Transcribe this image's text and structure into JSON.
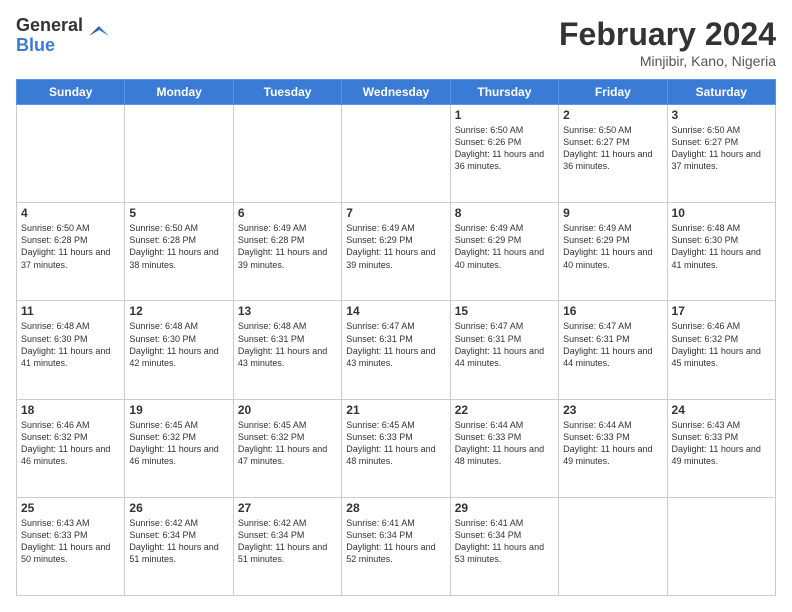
{
  "logo": {
    "general": "General",
    "blue": "Blue"
  },
  "header": {
    "month": "February 2024",
    "location": "Minjibir, Kano, Nigeria"
  },
  "days_of_week": [
    "Sunday",
    "Monday",
    "Tuesday",
    "Wednesday",
    "Thursday",
    "Friday",
    "Saturday"
  ],
  "weeks": [
    [
      {
        "day": "",
        "info": ""
      },
      {
        "day": "",
        "info": ""
      },
      {
        "day": "",
        "info": ""
      },
      {
        "day": "",
        "info": ""
      },
      {
        "day": "1",
        "info": "Sunrise: 6:50 AM\nSunset: 6:26 PM\nDaylight: 11 hours and 36 minutes."
      },
      {
        "day": "2",
        "info": "Sunrise: 6:50 AM\nSunset: 6:27 PM\nDaylight: 11 hours and 36 minutes."
      },
      {
        "day": "3",
        "info": "Sunrise: 6:50 AM\nSunset: 6:27 PM\nDaylight: 11 hours and 37 minutes."
      }
    ],
    [
      {
        "day": "4",
        "info": "Sunrise: 6:50 AM\nSunset: 6:28 PM\nDaylight: 11 hours and 37 minutes."
      },
      {
        "day": "5",
        "info": "Sunrise: 6:50 AM\nSunset: 6:28 PM\nDaylight: 11 hours and 38 minutes."
      },
      {
        "day": "6",
        "info": "Sunrise: 6:49 AM\nSunset: 6:28 PM\nDaylight: 11 hours and 39 minutes."
      },
      {
        "day": "7",
        "info": "Sunrise: 6:49 AM\nSunset: 6:29 PM\nDaylight: 11 hours and 39 minutes."
      },
      {
        "day": "8",
        "info": "Sunrise: 6:49 AM\nSunset: 6:29 PM\nDaylight: 11 hours and 40 minutes."
      },
      {
        "day": "9",
        "info": "Sunrise: 6:49 AM\nSunset: 6:29 PM\nDaylight: 11 hours and 40 minutes."
      },
      {
        "day": "10",
        "info": "Sunrise: 6:48 AM\nSunset: 6:30 PM\nDaylight: 11 hours and 41 minutes."
      }
    ],
    [
      {
        "day": "11",
        "info": "Sunrise: 6:48 AM\nSunset: 6:30 PM\nDaylight: 11 hours and 41 minutes."
      },
      {
        "day": "12",
        "info": "Sunrise: 6:48 AM\nSunset: 6:30 PM\nDaylight: 11 hours and 42 minutes."
      },
      {
        "day": "13",
        "info": "Sunrise: 6:48 AM\nSunset: 6:31 PM\nDaylight: 11 hours and 43 minutes."
      },
      {
        "day": "14",
        "info": "Sunrise: 6:47 AM\nSunset: 6:31 PM\nDaylight: 11 hours and 43 minutes."
      },
      {
        "day": "15",
        "info": "Sunrise: 6:47 AM\nSunset: 6:31 PM\nDaylight: 11 hours and 44 minutes."
      },
      {
        "day": "16",
        "info": "Sunrise: 6:47 AM\nSunset: 6:31 PM\nDaylight: 11 hours and 44 minutes."
      },
      {
        "day": "17",
        "info": "Sunrise: 6:46 AM\nSunset: 6:32 PM\nDaylight: 11 hours and 45 minutes."
      }
    ],
    [
      {
        "day": "18",
        "info": "Sunrise: 6:46 AM\nSunset: 6:32 PM\nDaylight: 11 hours and 46 minutes."
      },
      {
        "day": "19",
        "info": "Sunrise: 6:45 AM\nSunset: 6:32 PM\nDaylight: 11 hours and 46 minutes."
      },
      {
        "day": "20",
        "info": "Sunrise: 6:45 AM\nSunset: 6:32 PM\nDaylight: 11 hours and 47 minutes."
      },
      {
        "day": "21",
        "info": "Sunrise: 6:45 AM\nSunset: 6:33 PM\nDaylight: 11 hours and 48 minutes."
      },
      {
        "day": "22",
        "info": "Sunrise: 6:44 AM\nSunset: 6:33 PM\nDaylight: 11 hours and 48 minutes."
      },
      {
        "day": "23",
        "info": "Sunrise: 6:44 AM\nSunset: 6:33 PM\nDaylight: 11 hours and 49 minutes."
      },
      {
        "day": "24",
        "info": "Sunrise: 6:43 AM\nSunset: 6:33 PM\nDaylight: 11 hours and 49 minutes."
      }
    ],
    [
      {
        "day": "25",
        "info": "Sunrise: 6:43 AM\nSunset: 6:33 PM\nDaylight: 11 hours and 50 minutes."
      },
      {
        "day": "26",
        "info": "Sunrise: 6:42 AM\nSunset: 6:34 PM\nDaylight: 11 hours and 51 minutes."
      },
      {
        "day": "27",
        "info": "Sunrise: 6:42 AM\nSunset: 6:34 PM\nDaylight: 11 hours and 51 minutes."
      },
      {
        "day": "28",
        "info": "Sunrise: 6:41 AM\nSunset: 6:34 PM\nDaylight: 11 hours and 52 minutes."
      },
      {
        "day": "29",
        "info": "Sunrise: 6:41 AM\nSunset: 6:34 PM\nDaylight: 11 hours and 53 minutes."
      },
      {
        "day": "",
        "info": ""
      },
      {
        "day": "",
        "info": ""
      }
    ]
  ]
}
